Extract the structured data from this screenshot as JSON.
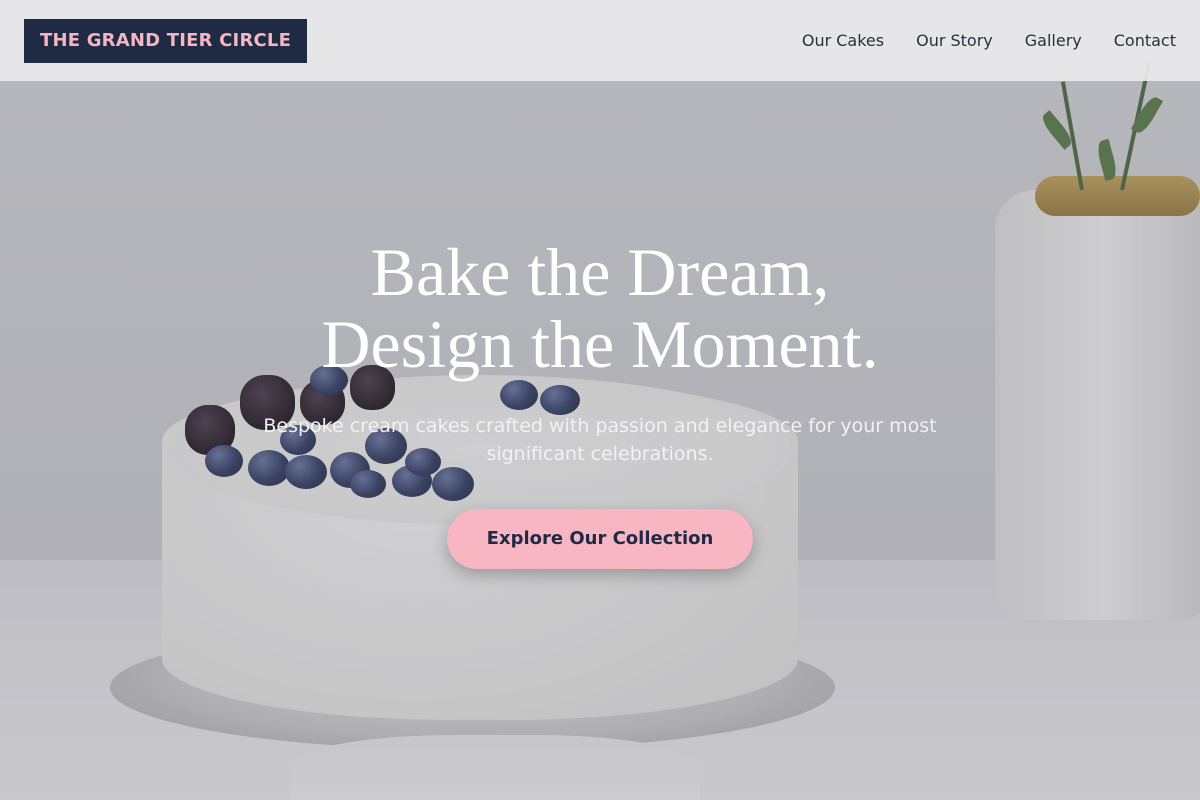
{
  "header": {
    "logo": "THE GRAND TIER CIRCLE",
    "nav": [
      {
        "label": "Our Cakes"
      },
      {
        "label": "Our Story"
      },
      {
        "label": "Gallery"
      },
      {
        "label": "Contact"
      }
    ]
  },
  "hero": {
    "headline_line1": "Bake the Dream,",
    "headline_line2": "Design the Moment.",
    "subtitle": "Bespoke cream cakes crafted with passion and elegance for your most significant celebrations.",
    "cta_label": "Explore Our Collection"
  },
  "colors": {
    "brand_navy": "#1f2a44",
    "brand_pink": "#f7b6c2",
    "header_bg": "#e9e9eb"
  }
}
